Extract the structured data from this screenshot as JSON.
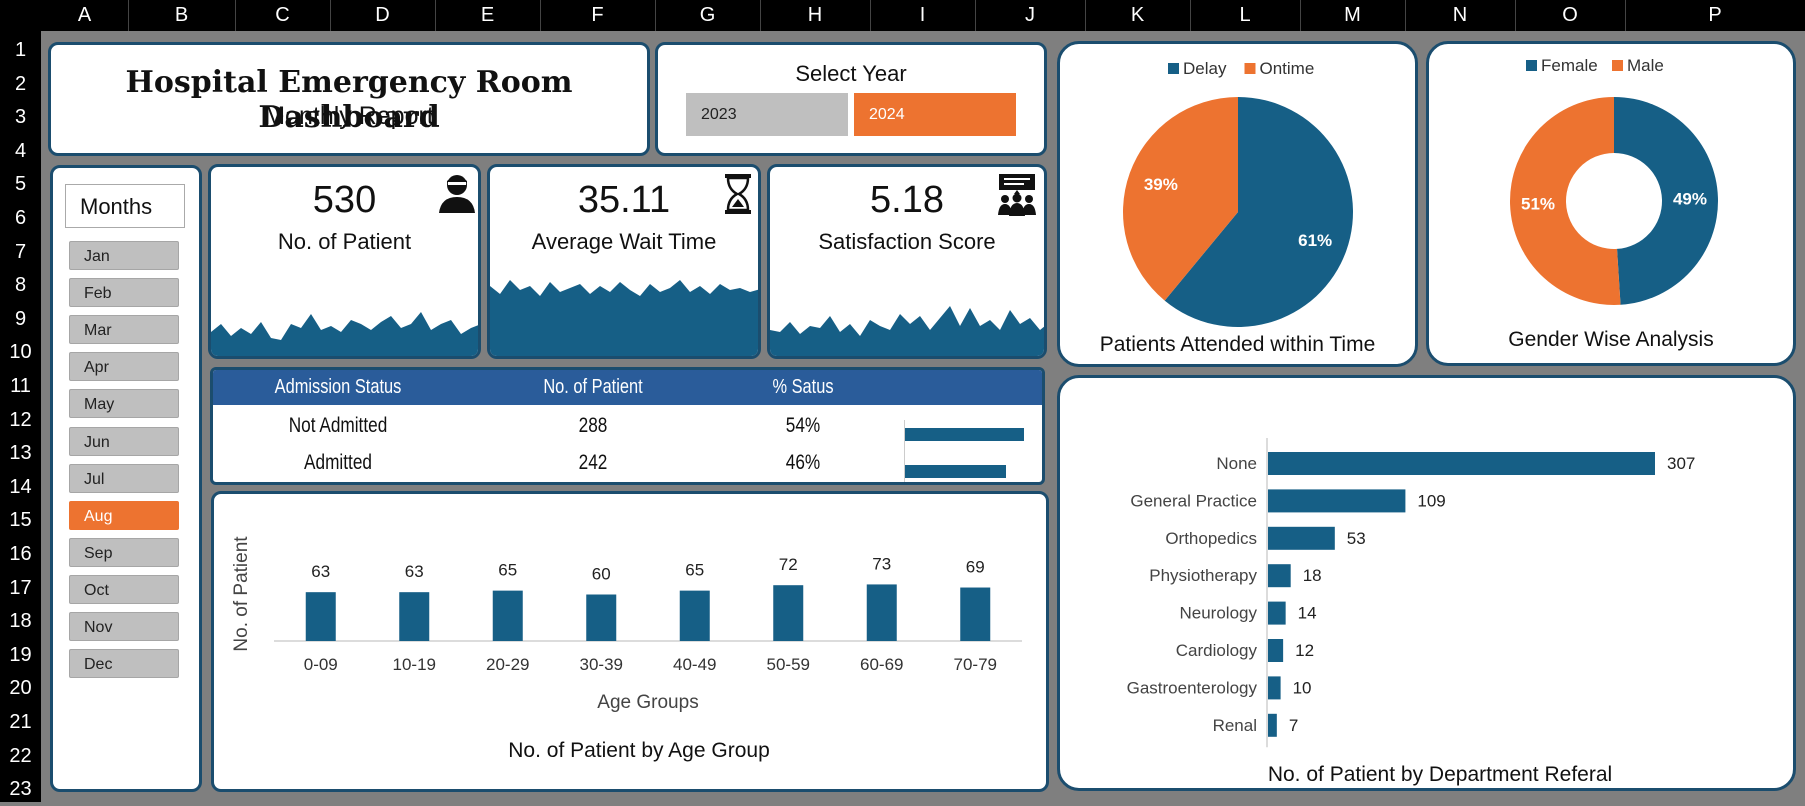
{
  "sheet": {
    "columns": [
      "A",
      "B",
      "C",
      "D",
      "E",
      "F",
      "G",
      "H",
      "I",
      "J",
      "K",
      "L",
      "M",
      "N",
      "O",
      "P"
    ],
    "rows": [
      "1",
      "2",
      "3",
      "4",
      "5",
      "6",
      "7",
      "8",
      "9",
      "10",
      "11",
      "12",
      "13",
      "14",
      "15",
      "16",
      "17",
      "18",
      "19",
      "20",
      "21",
      "22",
      "23"
    ]
  },
  "header": {
    "title": "Hospital Emergency Room Dashboard",
    "subtitle": "Monthly Report"
  },
  "year_selector": {
    "title": "Select Year",
    "years": [
      "2023",
      "2024"
    ],
    "selected": "2024"
  },
  "months": {
    "title": "Months",
    "items": [
      "Jan",
      "Feb",
      "Mar",
      "Apr",
      "May",
      "Jun",
      "Jul",
      "Aug",
      "Sep",
      "Oct",
      "Nov",
      "Dec"
    ],
    "selected": "Aug"
  },
  "kpis": [
    {
      "value": "530",
      "label": "No. of Patient",
      "icon": "patient-icon"
    },
    {
      "value": "35.11",
      "label": "Average Wait Time",
      "icon": "hourglass-icon"
    },
    {
      "value": "5.18",
      "label": "Satisfaction Score",
      "icon": "group-presentation-icon"
    }
  ],
  "admission_table": {
    "headers": [
      "Admission Status",
      "No. of Patient",
      "% Satus"
    ],
    "rows": [
      {
        "status": "Not Admitted",
        "count": "288",
        "pct": "54%",
        "share": 0.54
      },
      {
        "status": "Admitted",
        "count": "242",
        "pct": "46%",
        "share": 0.46
      }
    ]
  },
  "colors": {
    "primary": "#165f86",
    "accent": "#ed7330",
    "border": "#1b4d6e",
    "table_header": "#2a5c9a",
    "button_gray": "#bfbfbf"
  },
  "chart_data": [
    {
      "type": "pie",
      "title": "Patients Attended within Time",
      "labels": [
        "Delay",
        "Ontime"
      ],
      "values": [
        61,
        39
      ],
      "value_labels": [
        "61%",
        "39%"
      ],
      "legend": "top"
    },
    {
      "type": "pie",
      "variant": "donut",
      "title": "Gender Wise Analysis",
      "labels": [
        "Female",
        "Male"
      ],
      "values": [
        49,
        51
      ],
      "value_labels": [
        "49%",
        "51%"
      ],
      "legend": "top"
    },
    {
      "type": "bar",
      "title": "No. of Patient by Age Group",
      "xlabel": "Age Groups",
      "ylabel": "No. of Patient",
      "categories": [
        "0-09",
        "10-19",
        "20-29",
        "30-39",
        "40-49",
        "50-59",
        "60-69",
        "70-79"
      ],
      "values": [
        63,
        63,
        65,
        60,
        65,
        72,
        73,
        69
      ],
      "grid": false
    },
    {
      "type": "bar",
      "orientation": "horizontal",
      "title": "No. of Patient by Department Referal",
      "categories": [
        "None",
        "General Practice",
        "Orthopedics",
        "Physiotherapy",
        "Neurology",
        "Cardiology",
        "Gastroenterology",
        "Renal"
      ],
      "values": [
        307,
        109,
        53,
        18,
        14,
        12,
        10,
        7
      ],
      "grid": false
    }
  ]
}
